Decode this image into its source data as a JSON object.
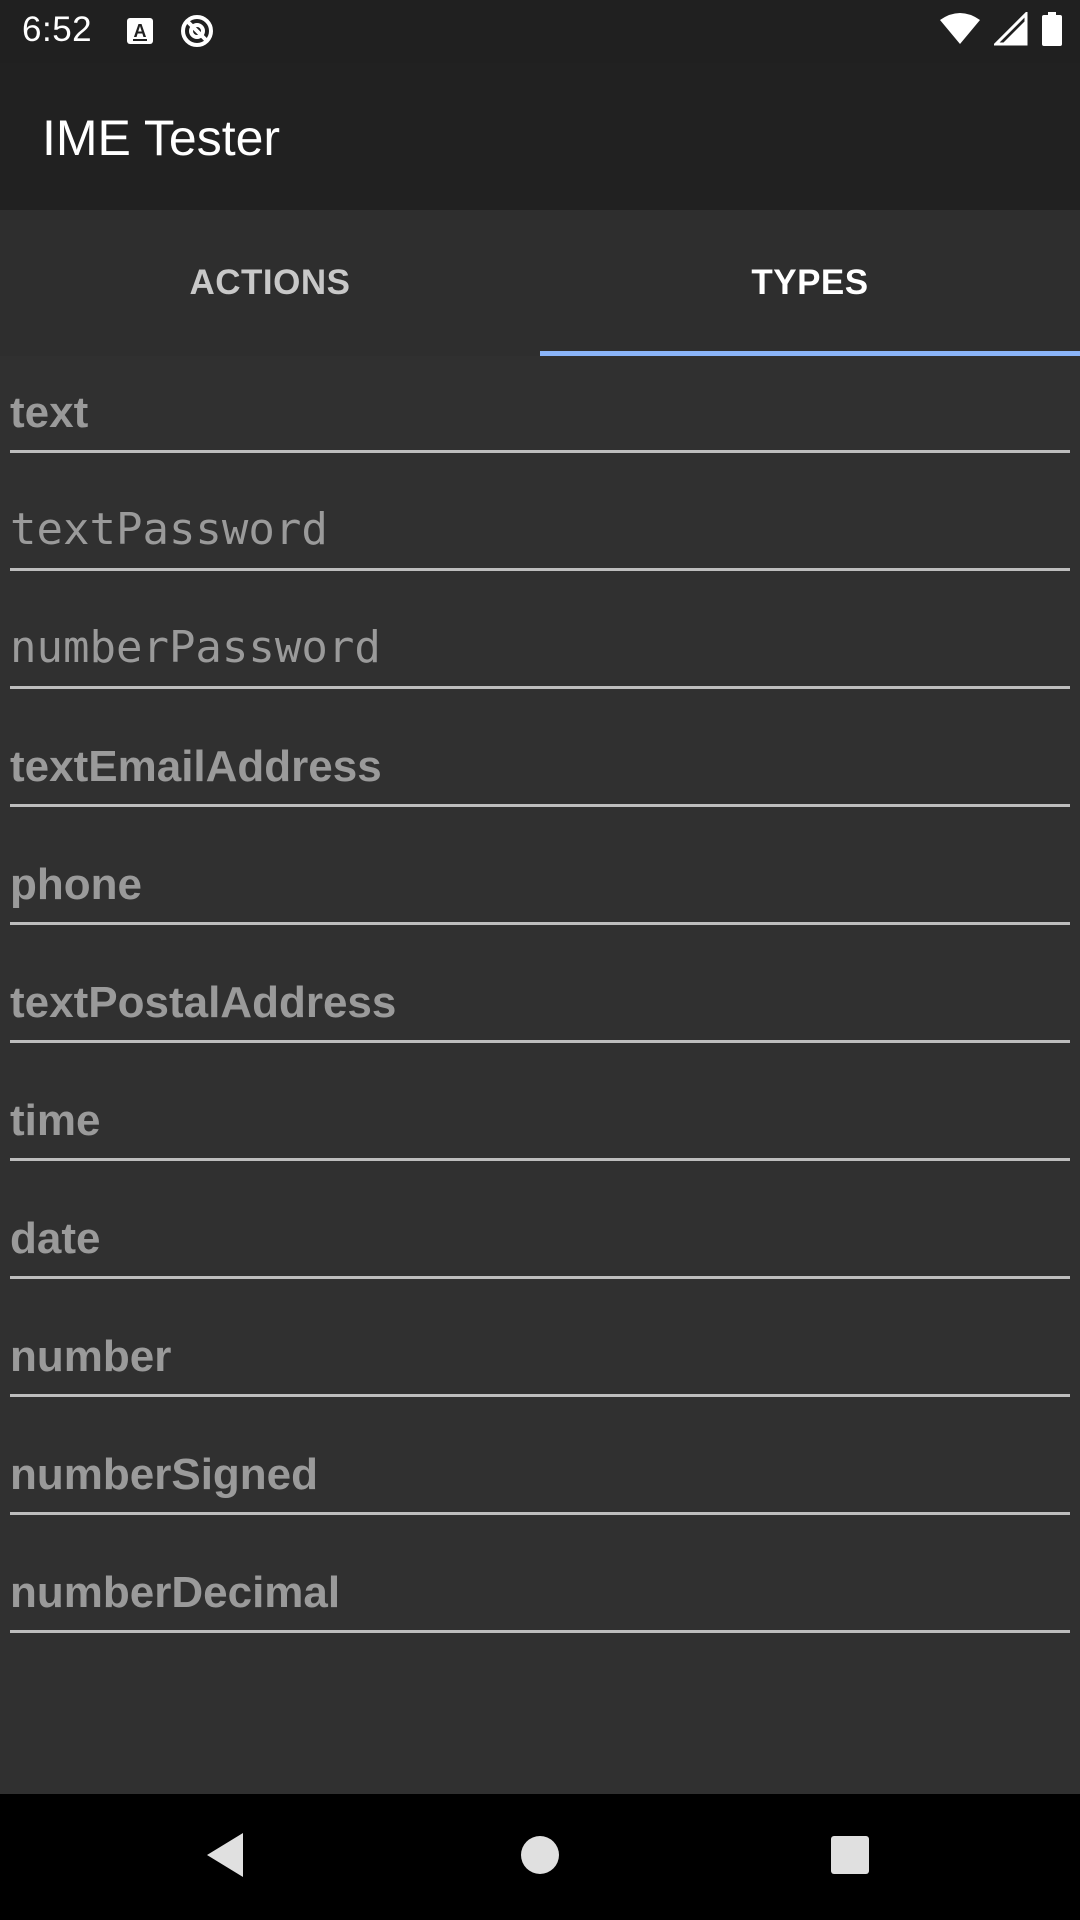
{
  "status_bar": {
    "time": "6:52",
    "left_icons": [
      "keyboard-a-icon",
      "no-sync-icon"
    ],
    "right_icons": [
      "wifi-icon",
      "cellular-signal-icon",
      "battery-icon"
    ]
  },
  "app_bar": {
    "title": "IME Tester"
  },
  "tabs": [
    {
      "label": "ACTIONS",
      "selected": false
    },
    {
      "label": "TYPES",
      "selected": true
    }
  ],
  "fields": [
    {
      "placeholder": "text",
      "input_type": "text"
    },
    {
      "placeholder": "textPassword",
      "input_type": "textPassword"
    },
    {
      "placeholder": "numberPassword",
      "input_type": "numberPassword"
    },
    {
      "placeholder": "textEmailAddress",
      "input_type": "textEmailAddress"
    },
    {
      "placeholder": "phone",
      "input_type": "phone"
    },
    {
      "placeholder": "textPostalAddress",
      "input_type": "textPostalAddress"
    },
    {
      "placeholder": "time",
      "input_type": "time"
    },
    {
      "placeholder": "date",
      "input_type": "date"
    },
    {
      "placeholder": "number",
      "input_type": "number"
    },
    {
      "placeholder": "numberSigned",
      "input_type": "numberSigned"
    },
    {
      "placeholder": "numberDecimal",
      "input_type": "numberDecimal"
    }
  ],
  "nav_bar": {
    "buttons": [
      "back-icon",
      "home-icon",
      "recents-icon"
    ]
  },
  "colors": {
    "background": "#303030",
    "app_bar": "#212121",
    "tab_indicator": "#8ab4f8",
    "placeholder_text": "#9a9a9a"
  }
}
